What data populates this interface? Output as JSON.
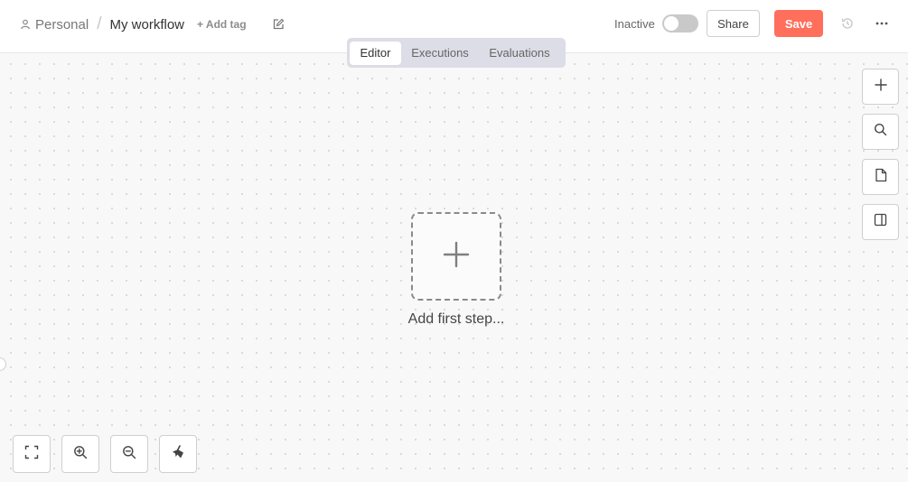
{
  "header": {
    "project": "Personal",
    "separator": "/",
    "workflow_name": "My workflow",
    "add_tag": "+ Add tag",
    "status_label": "Inactive",
    "share_label": "Share",
    "save_label": "Save"
  },
  "tabs": [
    {
      "label": "Editor",
      "active": true
    },
    {
      "label": "Executions",
      "active": false
    },
    {
      "label": "Evaluations",
      "active": false
    }
  ],
  "canvas": {
    "add_first_step_label": "Add first step..."
  },
  "colors": {
    "save_button": "#ff6f5c",
    "tab_bar": "#dcdde6",
    "canvas_background": "#f8f8f8"
  },
  "icons": {
    "right_toolbar": [
      "plus-icon",
      "search-icon",
      "sticky-note-icon",
      "panel-icon"
    ],
    "bottom_toolbar": [
      "fit-view-icon",
      "zoom-in-icon",
      "zoom-out-icon",
      "clean-up-icon"
    ]
  }
}
